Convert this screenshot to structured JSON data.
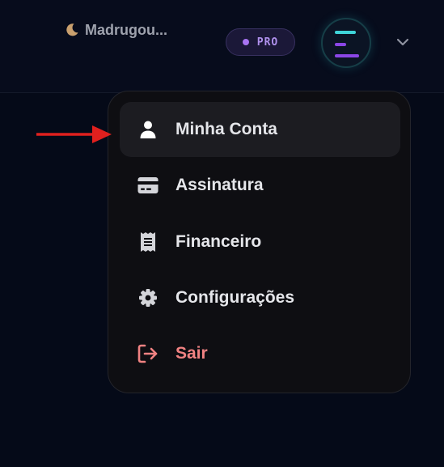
{
  "header": {
    "greeting": "Madrugou...",
    "greeting_icon": "moon-icon",
    "plan_badge": "PRO",
    "avatar_icon": "logo-lines-icon",
    "dropdown_icon": "chevron-down-icon"
  },
  "menu": {
    "items": [
      {
        "label": "Minha Conta",
        "icon": "user-icon",
        "state": "highlighted"
      },
      {
        "label": "Assinatura",
        "icon": "credit-card-icon",
        "state": "normal"
      },
      {
        "label": "Financeiro",
        "icon": "receipt-icon",
        "state": "normal"
      },
      {
        "label": "Configurações",
        "icon": "gear-icon",
        "state": "normal"
      },
      {
        "label": "Sair",
        "icon": "logout-icon",
        "state": "danger"
      }
    ]
  },
  "annotation": {
    "icon": "red-arrow-icon"
  },
  "colors": {
    "background": "#050a18",
    "menu_background": "#0e0e12",
    "pro_accent": "#a874f2",
    "danger": "#f08282",
    "annotation_arrow": "#e0201e",
    "avatar_cyan": "#3fd4d8",
    "avatar_purple": "#8b46e6"
  }
}
